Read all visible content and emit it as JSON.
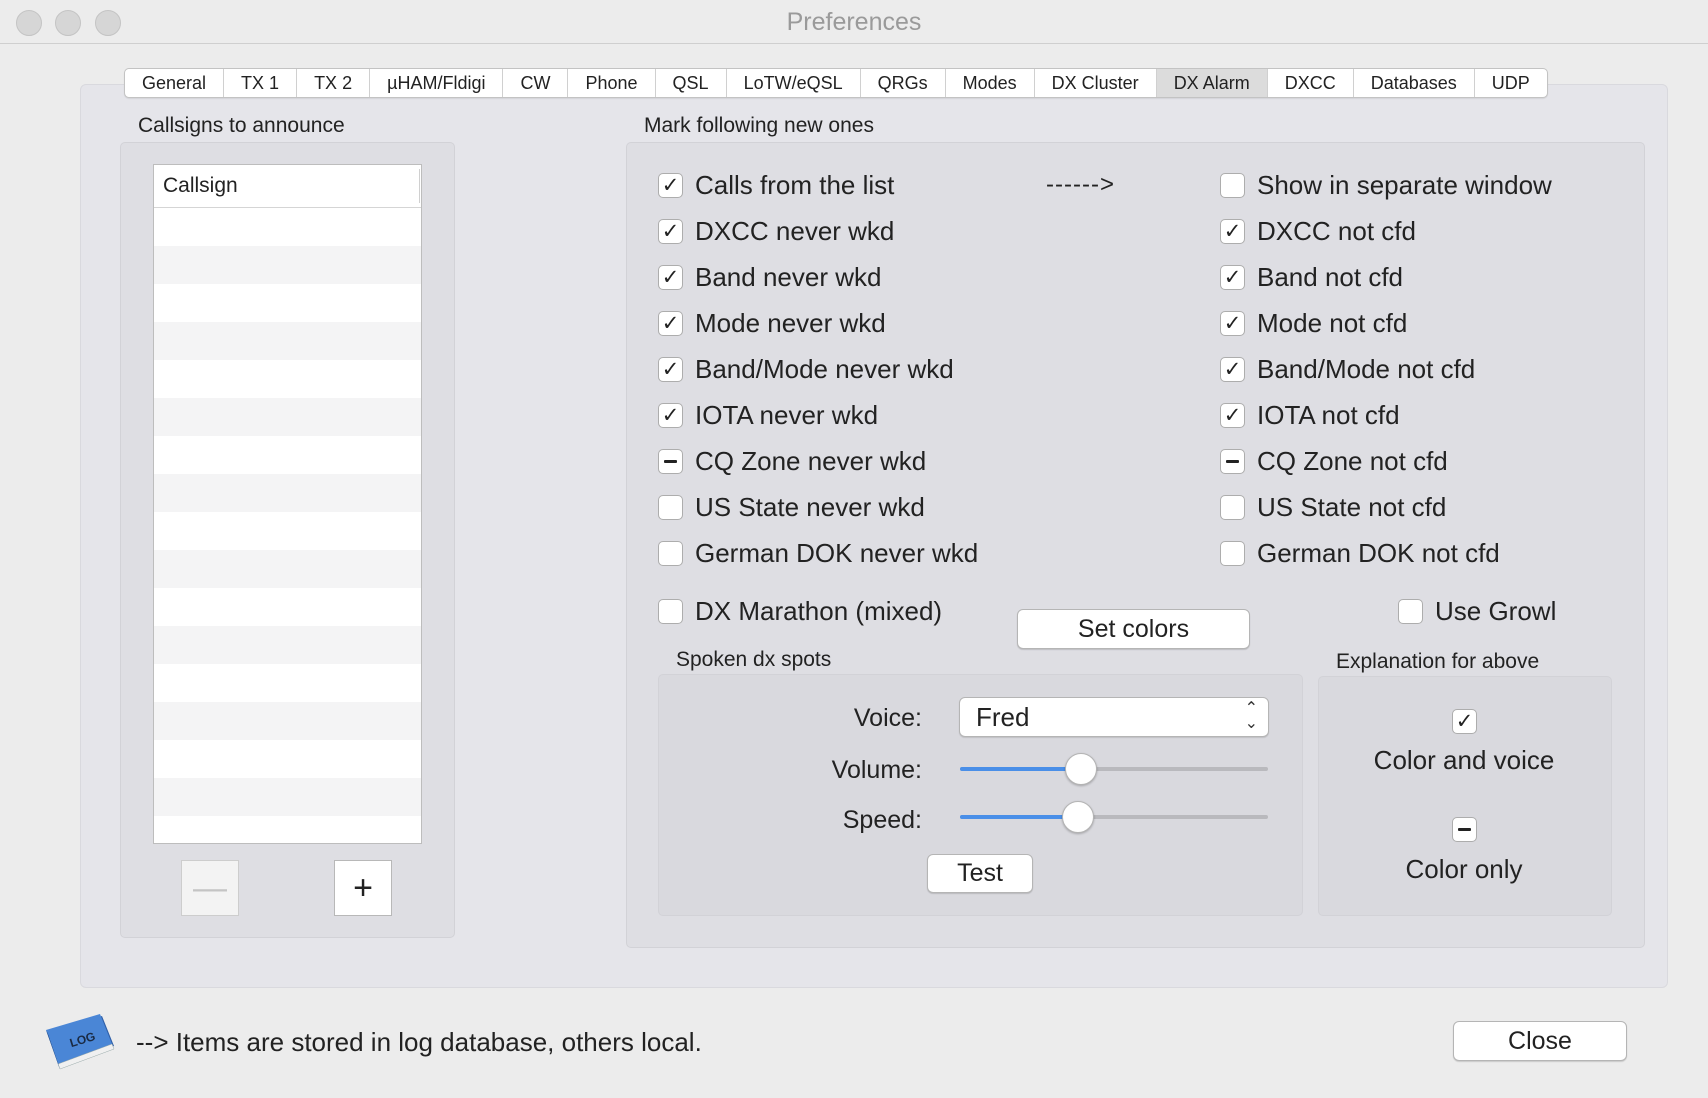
{
  "window": {
    "title": "Preferences"
  },
  "tabs": [
    {
      "label": "General"
    },
    {
      "label": "TX 1"
    },
    {
      "label": "TX 2"
    },
    {
      "label": "µHAM/Fldigi"
    },
    {
      "label": "CW"
    },
    {
      "label": "Phone"
    },
    {
      "label": "QSL"
    },
    {
      "label": "LoTW/eQSL"
    },
    {
      "label": "QRGs"
    },
    {
      "label": "Modes"
    },
    {
      "label": "DX Cluster"
    },
    {
      "label": "DX Alarm"
    },
    {
      "label": "DXCC"
    },
    {
      "label": "Databases"
    },
    {
      "label": "UDP"
    }
  ],
  "selected_tab": "DX Alarm",
  "callsigns": {
    "title": "Callsigns to announce",
    "column_header": "Callsign",
    "rows": [],
    "remove_label": "—",
    "add_label": "+"
  },
  "mark": {
    "title": "Mark following new ones",
    "arrow_text": "------>",
    "left": [
      {
        "label": "Calls from the list",
        "state": "checked"
      },
      {
        "label": "DXCC never wkd",
        "state": "checked"
      },
      {
        "label": "Band never wkd",
        "state": "checked"
      },
      {
        "label": "Mode never wkd",
        "state": "checked"
      },
      {
        "label": "Band/Mode never wkd",
        "state": "checked"
      },
      {
        "label": "IOTA never wkd",
        "state": "checked"
      },
      {
        "label": "CQ Zone never wkd",
        "state": "mixed"
      },
      {
        "label": "US State never wkd",
        "state": "unchecked"
      },
      {
        "label": "German DOK never wkd",
        "state": "unchecked"
      }
    ],
    "right": [
      {
        "label": "Show in separate window",
        "state": "unchecked"
      },
      {
        "label": "DXCC not cfd",
        "state": "checked"
      },
      {
        "label": "Band not cfd",
        "state": "checked"
      },
      {
        "label": "Mode not cfd",
        "state": "checked"
      },
      {
        "label": "Band/Mode not cfd",
        "state": "checked"
      },
      {
        "label": "IOTA not cfd",
        "state": "checked"
      },
      {
        "label": "CQ Zone not cfd",
        "state": "mixed"
      },
      {
        "label": "US State not cfd",
        "state": "unchecked"
      },
      {
        "label": "German DOK not cfd",
        "state": "unchecked"
      }
    ],
    "dx_marathon": {
      "label": "DX Marathon (mixed)",
      "state": "unchecked"
    },
    "set_colors_label": "Set colors",
    "use_growl": {
      "label": "Use Growl",
      "state": "unchecked"
    }
  },
  "spoken": {
    "title": "Spoken dx spots",
    "voice_label": "Voice:",
    "voice_value": "Fred",
    "volume_label": "Volume:",
    "volume_fraction": 0.39,
    "speed_label": "Speed:",
    "speed_fraction": 0.38,
    "test_label": "Test"
  },
  "explanation": {
    "title": "Explanation for above",
    "items": [
      {
        "label": "Color and voice",
        "state": "checked"
      },
      {
        "label": "Color only",
        "state": "mixed"
      }
    ]
  },
  "footer": {
    "log_icon_text": "LOG",
    "note": "--> Items are stored in log database, others local.",
    "close_label": "Close"
  },
  "colors": {
    "accent": "#4a8fe8",
    "tab_selected": "#dcdcdc",
    "panel": "#e5e5ea"
  }
}
